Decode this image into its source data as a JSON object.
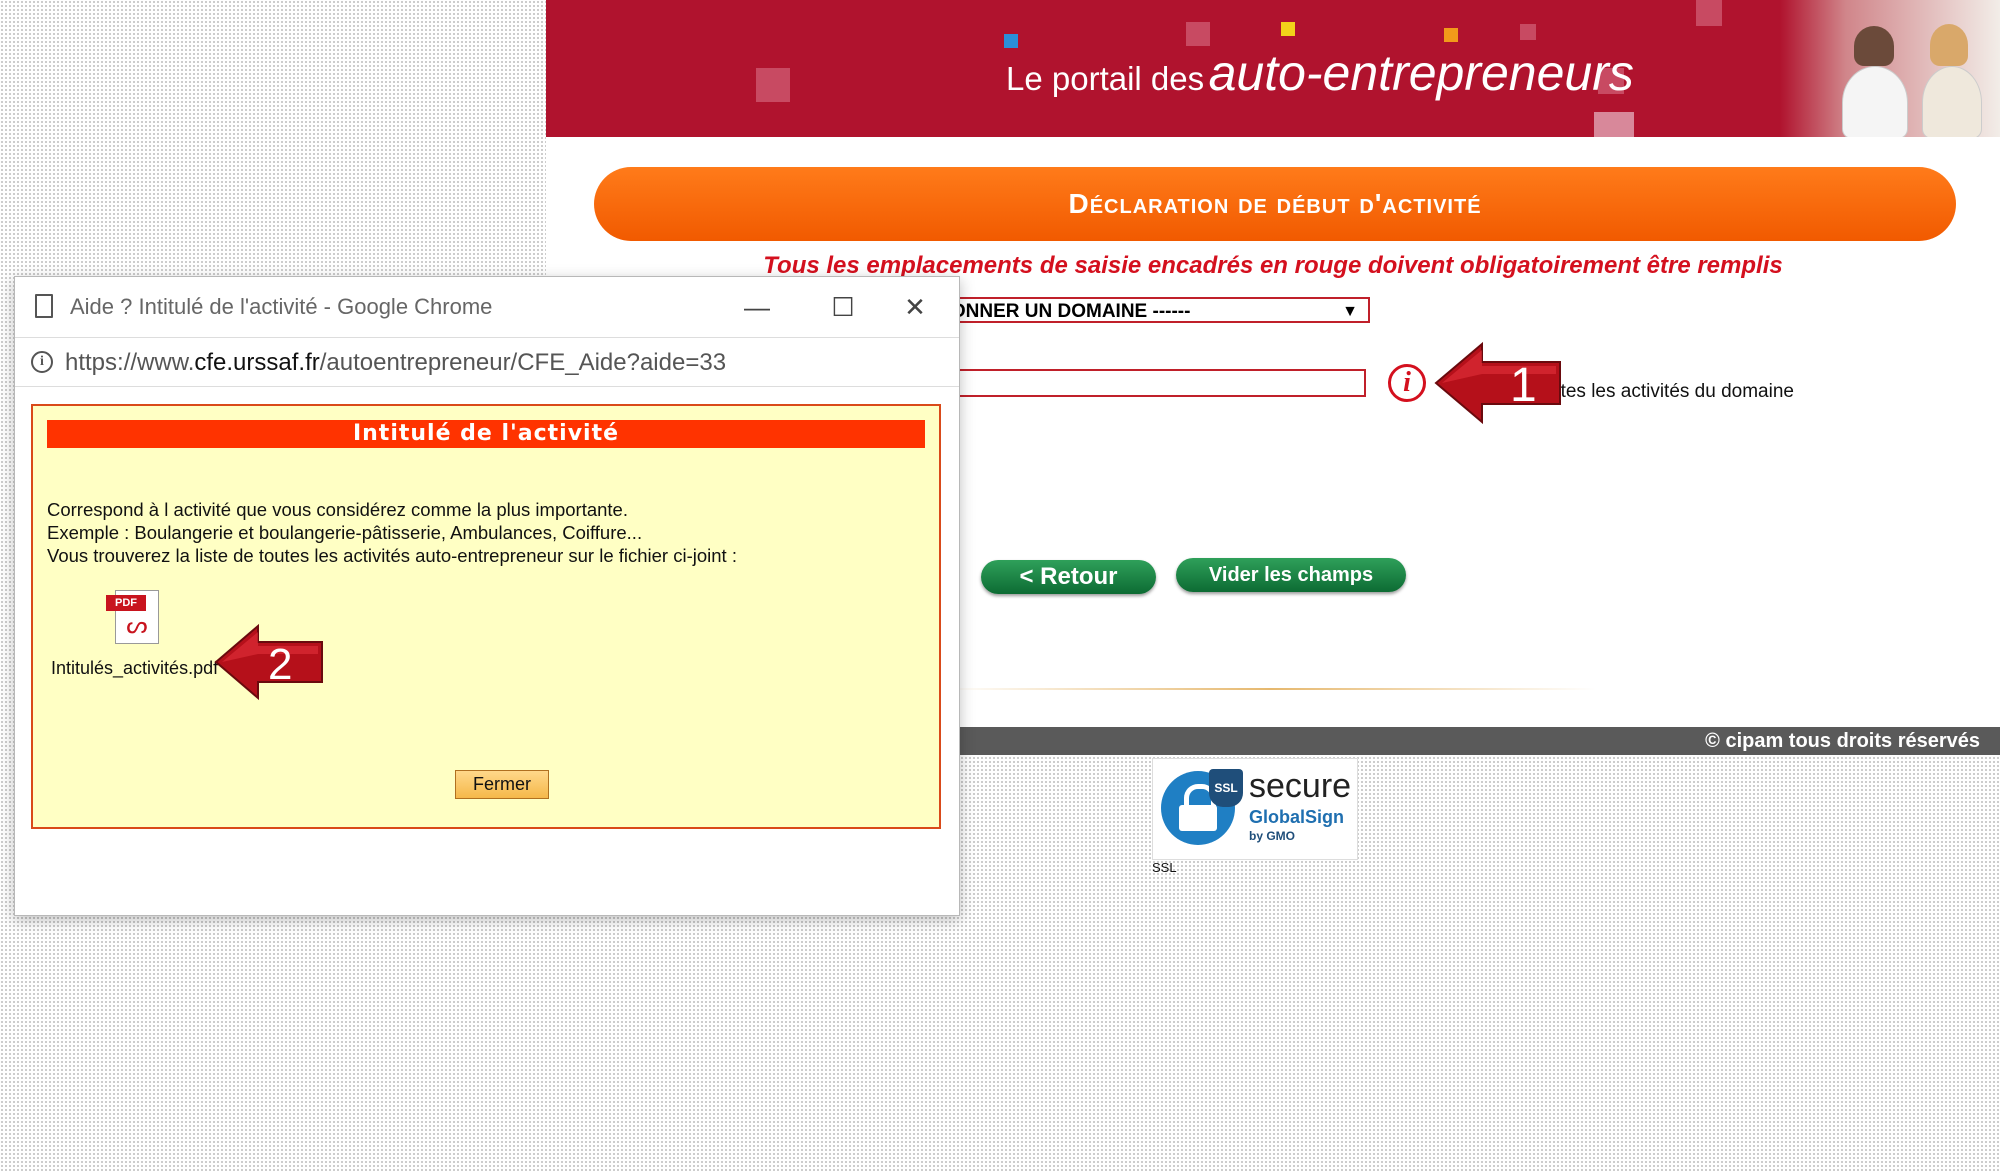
{
  "banner": {
    "title_small": "Le portail des",
    "title_big": "auto-entrepreneurs"
  },
  "form": {
    "section_title": "Déclaration de début d'activité",
    "required_note": "Tous les emplacements de saisie encadrés en rouge doivent obligatoirement être remplis",
    "domain_select_value": "TIONNER UN DOMAINE ------",
    "activity_input_value": "",
    "all_activities_label": "utes les activités du domaine",
    "retour_label": "< Retour",
    "vider_label": "Vider les champs"
  },
  "footer": {
    "copyright": "© cipam tous droits réservés"
  },
  "ssl_badge": {
    "secure": "secure",
    "globalsign": "GlobalSign",
    "gmo": "by GMO",
    "shield": "SSL",
    "label": "SSL"
  },
  "callouts": {
    "one": "1",
    "two": "2"
  },
  "popup": {
    "window_title": "Aide ? Intitulé de l'activité - Google Chrome",
    "url_prefix": "https://www.",
    "url_host": "cfe.urssaf.fr",
    "url_path": "/autoentrepreneur/CFE_Aide?aide=33",
    "help_title": "Intitulé de l'activité",
    "help_line1": "Correspond à l activité que vous considérez comme la plus importante.",
    "help_line2": "Exemple : Boulangerie et boulangerie-pâtisserie, Ambulances, Coiffure...",
    "help_line3": "Vous trouverez la liste de toutes les activités auto-entrepreneur sur le fichier ci-joint :",
    "pdf_tag": "PDF",
    "pdf_filename": "Intitulés_activités.pdf",
    "fermer_label": "Fermer"
  },
  "colors": {
    "banner": "#b0132e",
    "orange_bar": "#f15a00",
    "required_red": "#d4101e",
    "green_button": "#0d6b33",
    "help_bg": "#ffffc4",
    "help_header": "#ff3300"
  }
}
